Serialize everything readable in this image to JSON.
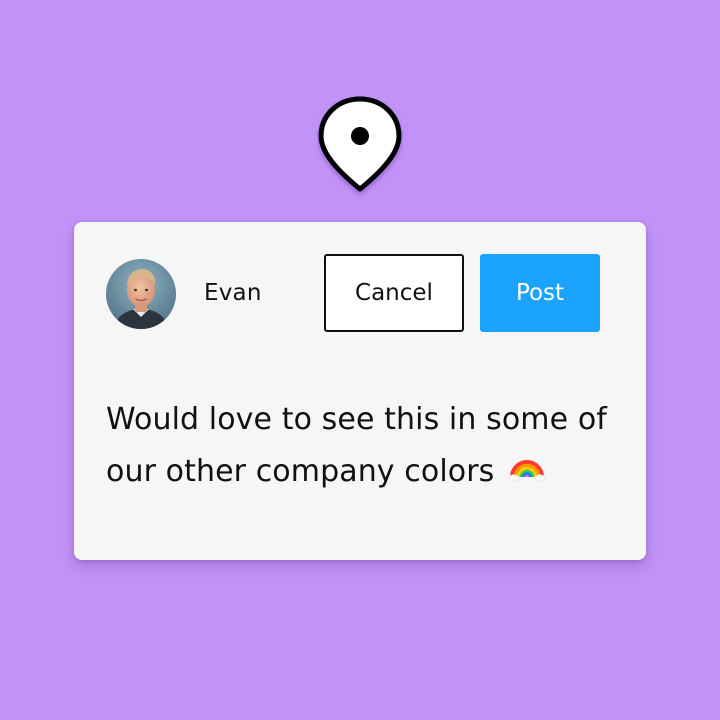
{
  "location_pin": {
    "icon": "location-pin-icon"
  },
  "comment": {
    "author": {
      "name": "Evan",
      "avatar_icon": "avatar-photo"
    },
    "actions": {
      "cancel_label": "Cancel",
      "post_label": "Post"
    },
    "text": "Would love to see this in some of our other company colors",
    "emoji_icon": "rainbow-icon"
  },
  "colors": {
    "background": "#c193f9",
    "card": "#f6f6f6",
    "post_button": "#1aa3ff",
    "text": "#111111"
  }
}
